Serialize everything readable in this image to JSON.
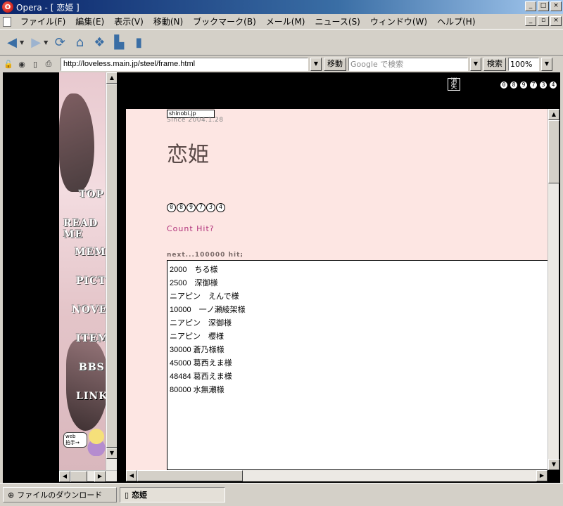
{
  "window": {
    "title": "Opera - [ 恋姫 ]",
    "controls": [
      "_",
      "□",
      "×"
    ],
    "mdi_controls": [
      "_",
      "▫",
      "×"
    ]
  },
  "menu": {
    "items": [
      "ファイル(F)",
      "編集(E)",
      "表示(V)",
      "移動(N)",
      "ブックマーク(B)",
      "メール(M)",
      "ニュース(S)",
      "ウィンドウ(W)",
      "ヘルプ(H)"
    ]
  },
  "toolbar": {
    "icons": [
      "back-arrow-icon",
      "forward-arrow-icon",
      "reload-icon",
      "home-icon",
      "hotlist-icon",
      "print-icon",
      "save-icon"
    ]
  },
  "address_bar": {
    "url": "http://loveless.main.jp/steel/frame.html",
    "go_label": "移動",
    "search_placeholder": "Google で検索",
    "search_label": "検索",
    "zoom": "100%"
  },
  "left_nav": {
    "links": [
      "TOP",
      "READ ME",
      "MEMO",
      "PICT",
      "NOVEL",
      "ITEM",
      "BBS",
      "LINK"
    ],
    "badge_text": "web\n拍手→"
  },
  "right_frame": {
    "top_counter_digits": [
      "0",
      "8",
      "9",
      "7",
      "3",
      "4"
    ],
    "shoukyo_label": "消失"
  },
  "page": {
    "shinobi": "shinobi.jp",
    "since": "Since 2004.1.28",
    "title": "恋姫",
    "counter_digits": [
      "0",
      "8",
      "9",
      "7",
      "3",
      "4"
    ],
    "count_hit": "Count Hit?",
    "next_label": "next...100000 hit;",
    "hits": [
      "2000　ちる様",
      "2500　深御様",
      "ニアピン　えんで様",
      "10000　一ノ瀬綾架様",
      "ニアピン　深御様",
      "ニアピン　櫻様",
      "30000 蒼乃様様",
      "45000 葛西えま様",
      "48484 葛西えま様",
      "80000 水無瀬様"
    ]
  },
  "status": {
    "download_tab": "ファイルのダウンロード",
    "page_tab": "恋姫"
  }
}
